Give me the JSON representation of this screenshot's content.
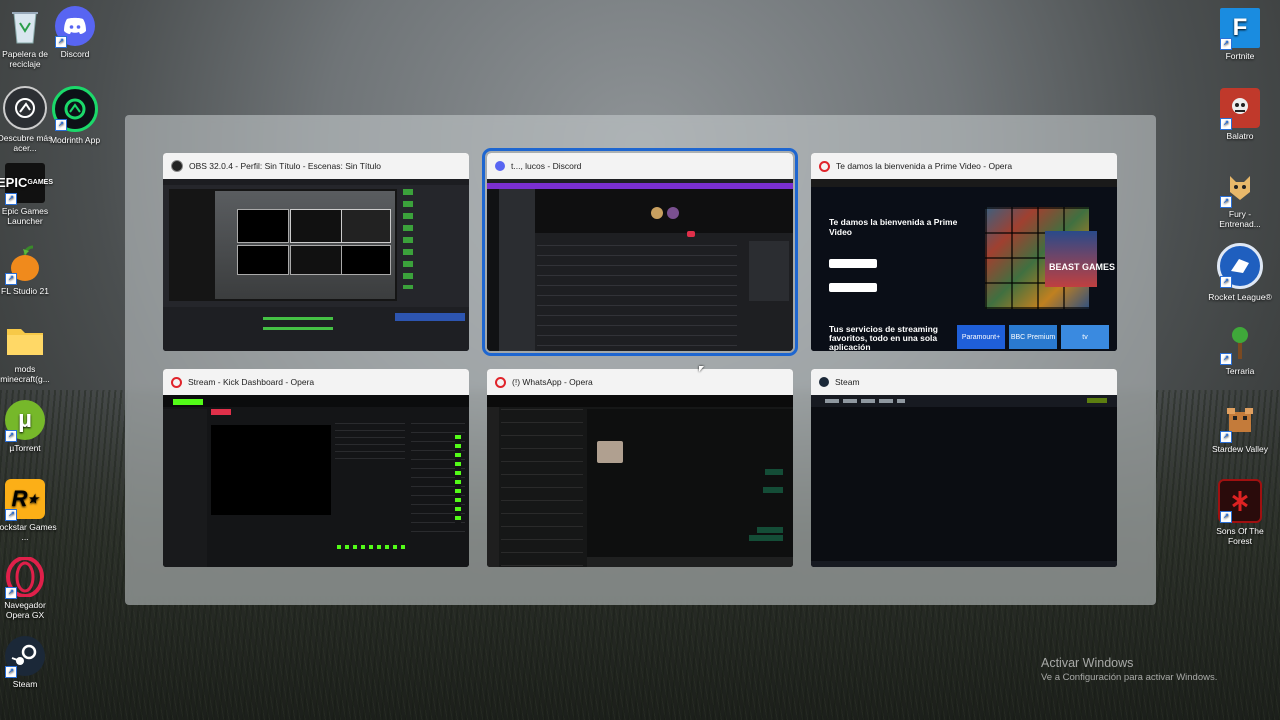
{
  "desktop_left": [
    {
      "label": "Papelera de reciclaje",
      "icon": "recycle-bin-icon"
    },
    {
      "label": "Discord",
      "icon": "discord-icon"
    },
    {
      "label": "Descubre más acer...",
      "icon": "acer-discover-icon"
    },
    {
      "label": "Modrinth App",
      "icon": "modrinth-icon"
    },
    {
      "label": "Epic Games Launcher",
      "icon": "epic-games-icon"
    },
    {
      "label": "FL Studio 21",
      "icon": "fl-studio-icon"
    },
    {
      "label": "mods minecraft(g...",
      "icon": "folder-icon"
    },
    {
      "label": "µTorrent",
      "icon": "utorrent-icon"
    },
    {
      "label": "Rockstar Games ...",
      "icon": "rockstar-icon"
    },
    {
      "label": "Navegador Opera GX",
      "icon": "opera-gx-icon"
    },
    {
      "label": "Steam",
      "icon": "steam-icon"
    }
  ],
  "desktop_right": [
    {
      "label": "Fortnite",
      "icon": "fortnite-icon"
    },
    {
      "label": "Balatro",
      "icon": "balatro-icon"
    },
    {
      "label": "Fury - Entrenad...",
      "icon": "fury-icon"
    },
    {
      "label": "Rocket League®",
      "icon": "rocket-league-icon"
    },
    {
      "label": "Terraria",
      "icon": "terraria-icon"
    },
    {
      "label": "Stardew Valley",
      "icon": "stardew-icon"
    },
    {
      "label": "Sons Of The Forest",
      "icon": "sons-forest-icon"
    }
  ],
  "windows": [
    {
      "title": "OBS 32.0.4 - Perfil: Sin Título - Escenas: Sin Título",
      "icon": "obs-icon",
      "color": "#222222"
    },
    {
      "title": "t..., lucos - Discord",
      "icon": "discord-icon",
      "color": "#5865f2"
    },
    {
      "title": "Te damos la bienvenida a Prime Video - Opera",
      "icon": "opera-icon",
      "color": "#e0242b"
    },
    {
      "title": "Stream - Kick Dashboard - Opera",
      "icon": "opera-icon",
      "color": "#e0242b"
    },
    {
      "title": "(!) WhatsApp - Opera",
      "icon": "opera-icon",
      "color": "#e0242b"
    },
    {
      "title": "Steam",
      "icon": "steam-icon",
      "color": "#1b2838"
    }
  ],
  "prime": {
    "headline": "Te damos la bienvenida a Prime Video",
    "streaming": "Tus servicios de streaming favoritos, todo en una sola aplicación",
    "badge1": "Paramount+",
    "badge2": "BBC Premium",
    "badge3": "tv",
    "beast": "BEAST GAMES"
  },
  "watermark": {
    "line1": "Activar Windows",
    "line2": "Ve a Configuración para activar Windows."
  }
}
